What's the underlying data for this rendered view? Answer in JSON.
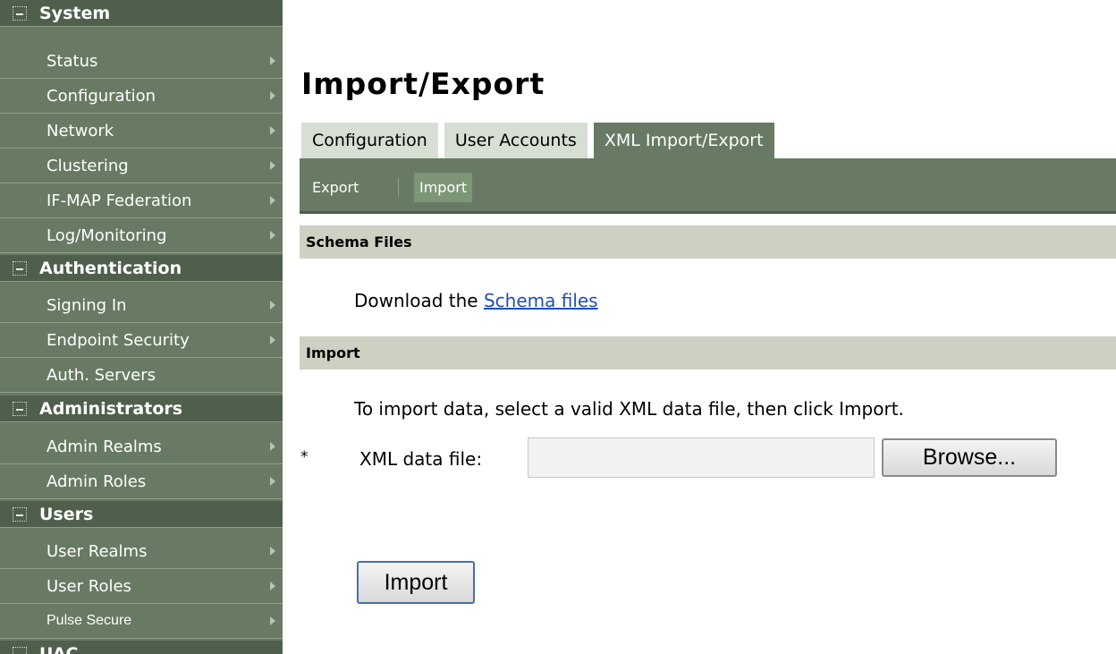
{
  "sidebar": {
    "sections": [
      {
        "title": "System"
      },
      {
        "title": "Authentication"
      },
      {
        "title": "Administrators"
      },
      {
        "title": "Users"
      },
      {
        "title": "UAC"
      }
    ],
    "items": [
      {
        "label": "Status"
      },
      {
        "label": "Configuration"
      },
      {
        "label": "Network"
      },
      {
        "label": "Clustering"
      },
      {
        "label": "IF-MAP Federation"
      },
      {
        "label": "Log/Monitoring"
      },
      {
        "label": "Signing In"
      },
      {
        "label": "Endpoint Security"
      },
      {
        "label": "Auth. Servers"
      },
      {
        "label": "Admin Realms"
      },
      {
        "label": "Admin Roles"
      },
      {
        "label": "User Realms"
      },
      {
        "label": "User Roles"
      },
      {
        "label": "Pulse Secure"
      }
    ]
  },
  "main": {
    "title": "Import/Export",
    "tabs": [
      {
        "label": "Configuration"
      },
      {
        "label": "User Accounts"
      },
      {
        "label": "XML Import/Export"
      }
    ],
    "subnav": {
      "export": "Export",
      "import": "Import"
    },
    "schema_section": {
      "title": "Schema Files",
      "text": "Download the",
      "link": "Schema files"
    },
    "import_section": {
      "title": "Import",
      "instructions": "To import data, select a valid XML data file, then click Import.",
      "required_marker": "*",
      "file_label": "XML data file:",
      "file_value": "",
      "browse_label": "Browse...",
      "import_label": "Import"
    }
  },
  "colors": {
    "sidebar_bg": "#687a63",
    "section_header_bg": "#4f5f4b",
    "tab_inactive_bg": "#d7dfd4",
    "section_bar_bg": "#cfcfc3",
    "link": "#1f4fb5"
  }
}
